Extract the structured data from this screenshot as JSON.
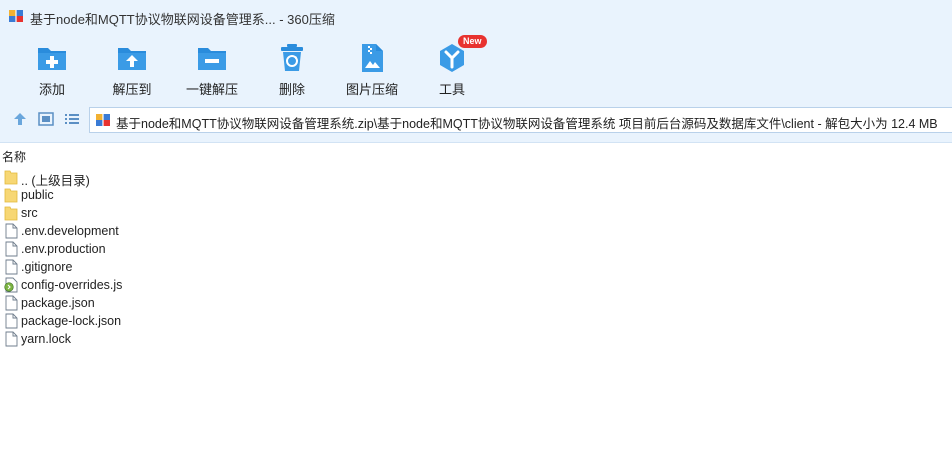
{
  "window": {
    "title": "基于node和MQTT协议物联网设备管理系... - 360压缩"
  },
  "toolbar": {
    "items": [
      {
        "label": "添加",
        "icon": "add-folder-icon"
      },
      {
        "label": "解压到",
        "icon": "extract-to-icon"
      },
      {
        "label": "一键解压",
        "icon": "one-click-extract-icon"
      },
      {
        "label": "删除",
        "icon": "recycle-bin-icon"
      },
      {
        "label": "图片压缩",
        "icon": "image-compress-icon"
      },
      {
        "label": "工具",
        "icon": "tools-icon",
        "badge": "New"
      }
    ]
  },
  "address": {
    "path": "基于node和MQTT协议物联网设备管理系统.zip\\基于node和MQTT协议物联网设备管理系统 项目前后台源码及数据库文件\\client - 解包大小为 12.4 MB"
  },
  "list": {
    "header_name": "名称",
    "files": [
      {
        "name": ".. (上级目录)",
        "type": "folder"
      },
      {
        "name": "public",
        "type": "folder"
      },
      {
        "name": "src",
        "type": "folder"
      },
      {
        "name": ".env.development",
        "type": "file"
      },
      {
        "name": ".env.production",
        "type": "file"
      },
      {
        "name": ".gitignore",
        "type": "file"
      },
      {
        "name": "config-overrides.js",
        "type": "js"
      },
      {
        "name": "package.json",
        "type": "file"
      },
      {
        "name": "package-lock.json",
        "type": "file"
      },
      {
        "name": "yarn.lock",
        "type": "file"
      }
    ]
  },
  "colors": {
    "chrome_bg": "#e9f3fd",
    "icon_blue": "#2a8cdc",
    "badge_red": "#e8322f",
    "folder_yellow": "#f7d774"
  }
}
